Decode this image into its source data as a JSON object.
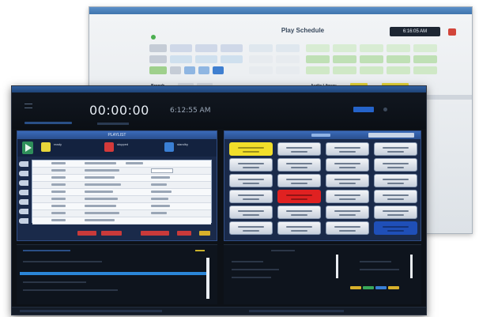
{
  "schedule_window": {
    "title": "Play Schedule",
    "clock": "6:16:05 AM",
    "branch_label": "Branch",
    "audio_library_label": "Audio Library"
  },
  "player_window": {
    "elapsed": "00:00:00",
    "time_of_day": "6:12:55 AM",
    "playlist_header": "PLAYLIST",
    "decks": [
      {
        "status": "ready",
        "color": "#e7d53a"
      },
      {
        "status": "stopped",
        "color": "#d43a3a"
      },
      {
        "status": "standby",
        "color": "#3a7fd4"
      }
    ]
  },
  "colors": {
    "accent": "#2563c9",
    "cart_active": "#f2df2a",
    "cart_alert": "#e02121",
    "cart_selected": "#1f4fb8",
    "meter": "#2b86d8"
  }
}
